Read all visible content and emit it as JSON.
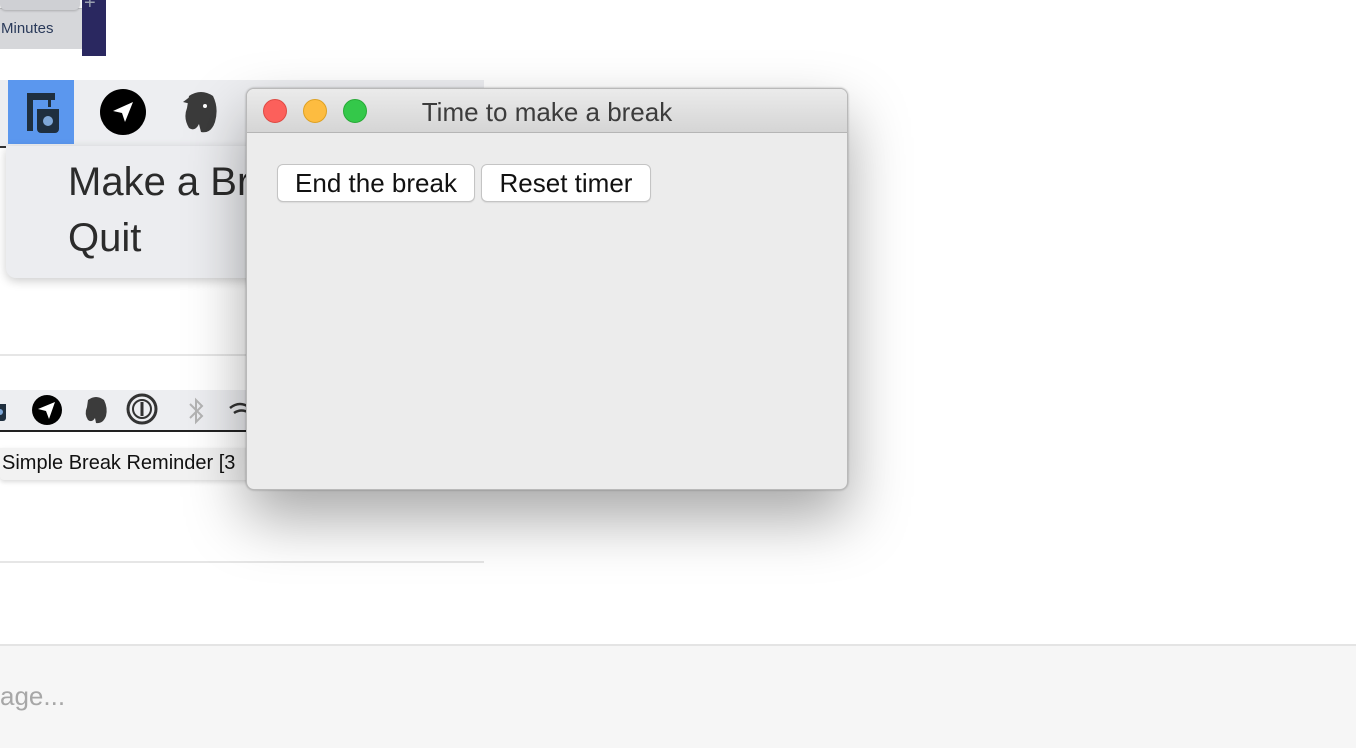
{
  "top_fragment": {
    "label": "Minutes",
    "plus": "+"
  },
  "menubar": {
    "icons": [
      "break-reminder-icon",
      "telegram-icon",
      "evernote-icon"
    ]
  },
  "dropdown": {
    "items": [
      "Make a Br",
      "Quit"
    ]
  },
  "small_menubar": {
    "icons": [
      "break-reminder-icon",
      "telegram-icon",
      "evernote-icon",
      "onepassword-icon",
      "bluetooth-icon",
      "wifi-icon"
    ]
  },
  "tooltip": {
    "text": "Simple Break Reminder [3"
  },
  "dialog": {
    "title": "Time to make a break",
    "buttons": {
      "end": "End the break",
      "reset": "Reset timer"
    }
  },
  "composer": {
    "value": "age..."
  }
}
